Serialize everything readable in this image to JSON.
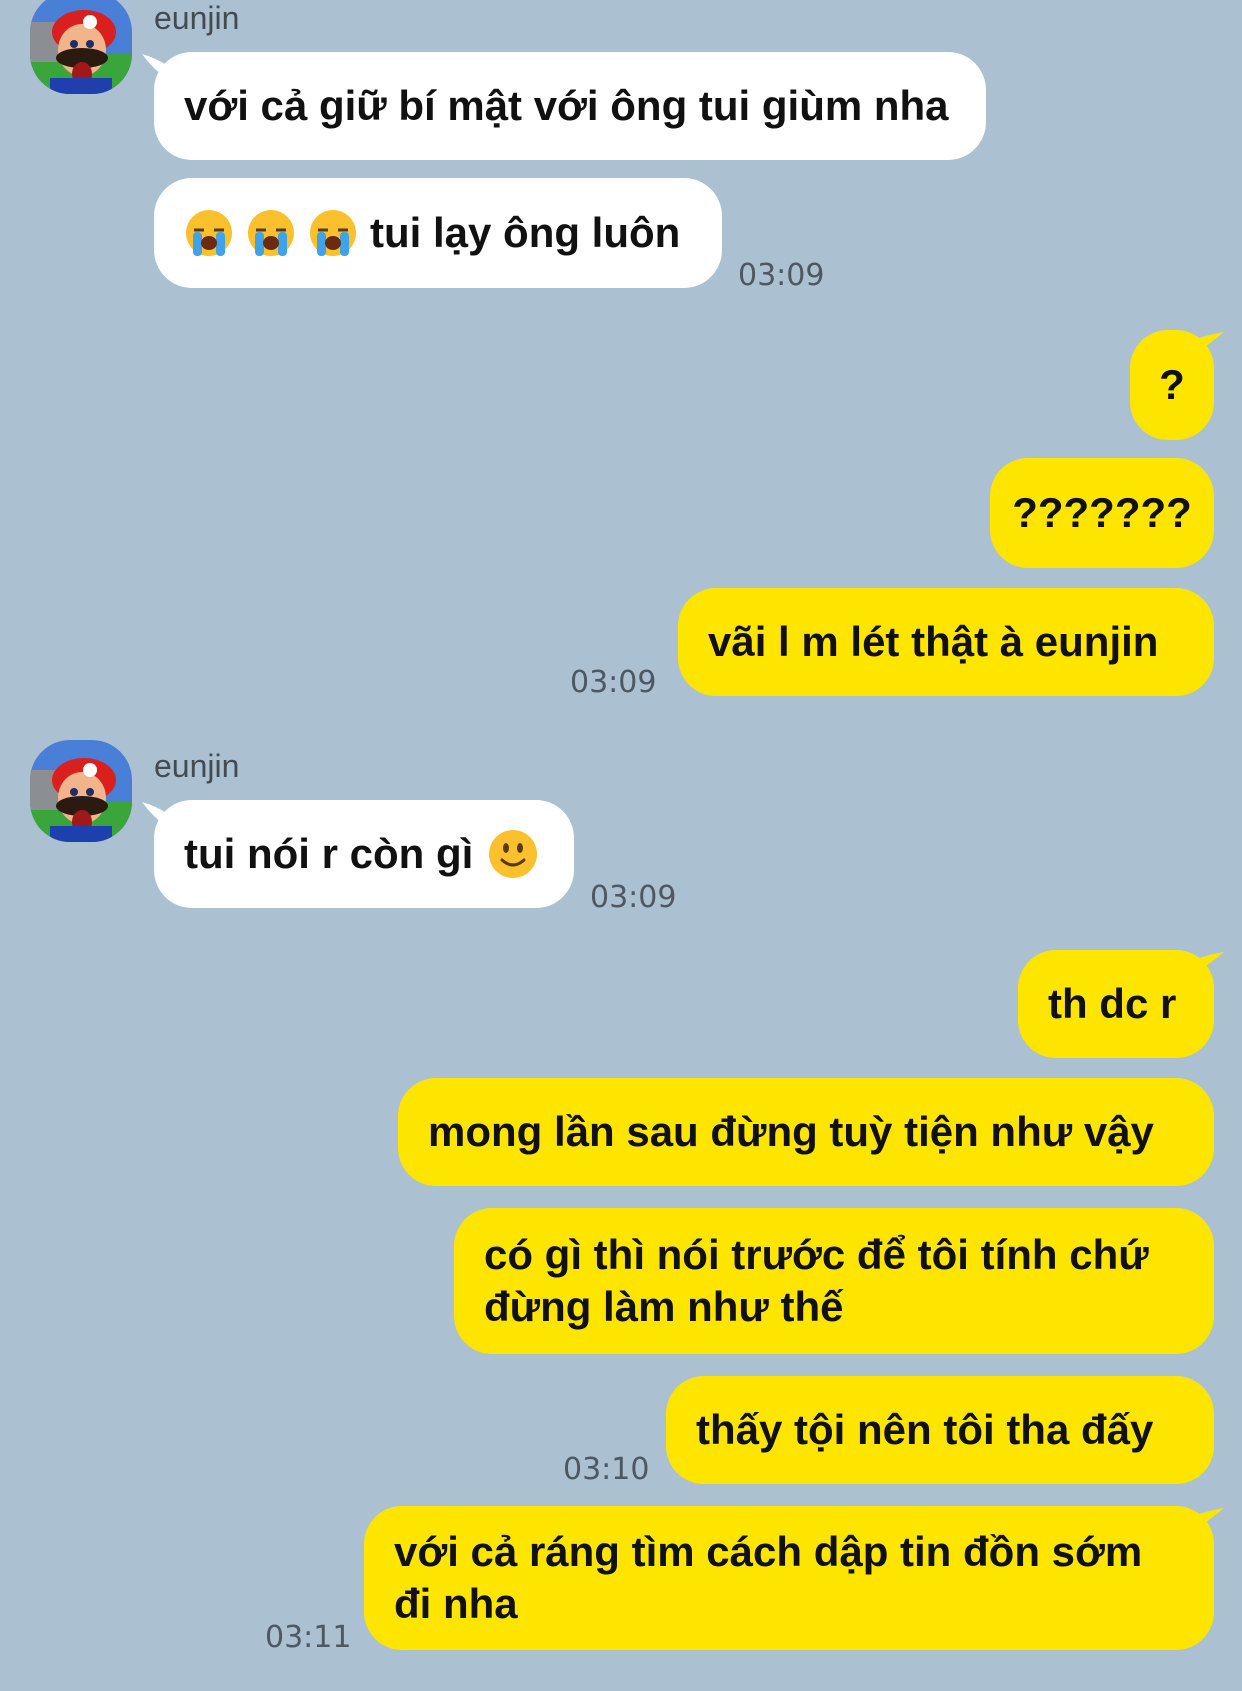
{
  "colors": {
    "background": "#abc1d1",
    "incoming_bubble": "#ffffff",
    "outgoing_bubble": "#fee500"
  },
  "groups": [
    {
      "sender": "eunjin",
      "messages": [
        "với cả giữ bí mật với ông tui giùm nha",
        "tui lạy ông luôn"
      ],
      "time": "03:09"
    },
    {
      "messages": [
        "?",
        "???????",
        "vãi l m lét thật à eunjin"
      ],
      "time": "03:09"
    },
    {
      "sender": "eunjin",
      "messages": [
        "tui nói r còn gì"
      ],
      "time": "03:09"
    },
    {
      "messages": [
        "th dc r",
        "mong lần sau đừng tuỳ tiện như vậy",
        "có gì thì nói trước để tôi tính chứ đừng làm như thế",
        "thấy tội nên tôi tha đấy"
      ],
      "time": "03:10"
    },
    {
      "messages": [
        "với cả ráng tìm cách dập tin đồn sớm đi nha"
      ],
      "time": "03:11"
    }
  ],
  "icons": {
    "avatar": "mario-avatar-icon",
    "crying": "loudly-crying-face-emoji",
    "smile": "slightly-smiling-face-emoji"
  }
}
